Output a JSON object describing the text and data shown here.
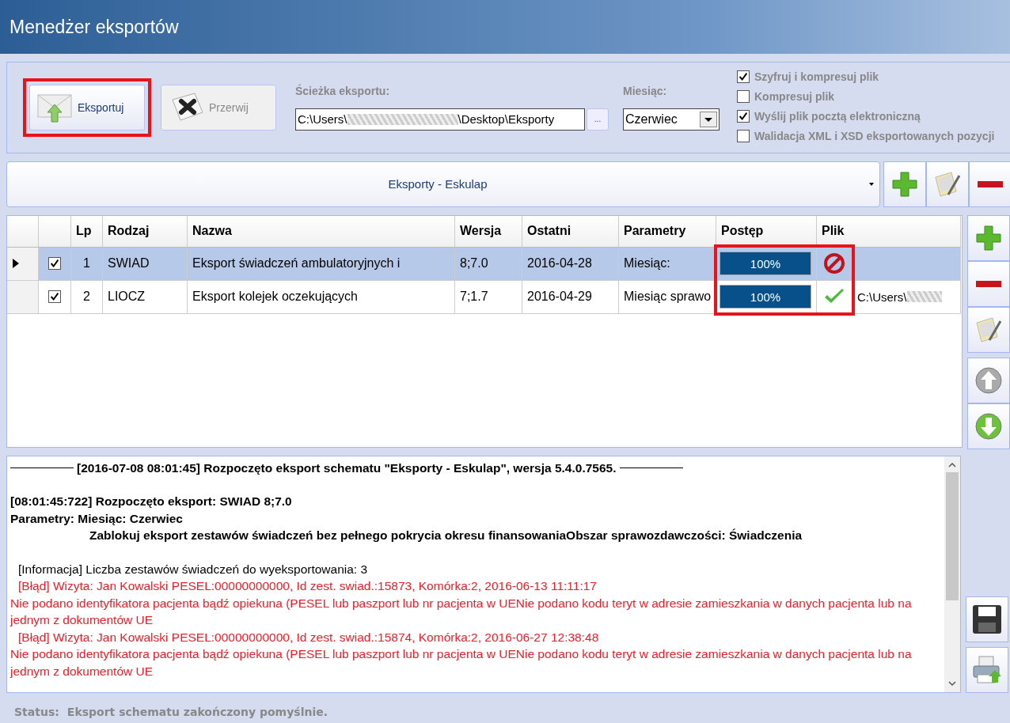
{
  "window": {
    "title": "Menedżer eksportów"
  },
  "toolbar": {
    "buttons": [
      {
        "label": "Eksportuj",
        "kind": "export",
        "disabled": false,
        "highlighted": true
      },
      {
        "label": "Przerwij",
        "kind": "abort",
        "disabled": true,
        "highlighted": false
      }
    ],
    "path": {
      "label": "Ścieżka eksportu:",
      "value_start": "C:\\Users\\",
      "value_end": "\\Desktop\\Eksporty",
      "browse": "..."
    },
    "month": {
      "label": "Miesiąc:",
      "value": "Czerwiec"
    },
    "options": [
      {
        "label": "Szyfruj i kompresuj plik",
        "checked": true
      },
      {
        "label": "Kompresuj plik",
        "checked": false
      },
      {
        "label": "Wyślij plik pocztą elektroniczną",
        "checked": true
      },
      {
        "label": "Walidacja XML i XSD eksportowanych pozycji",
        "checked": false
      }
    ]
  },
  "scheme": {
    "value": "Eksporty - Eskulap",
    "actions": [
      {
        "kind": "add"
      },
      {
        "kind": "edit"
      },
      {
        "kind": "remove"
      }
    ]
  },
  "table": {
    "columns": [
      "Lp",
      "Rodzaj",
      "Nazwa",
      "Wersja",
      "Ostatni",
      "Parametry",
      "Postęp",
      "Plik"
    ],
    "progress_highlighted": true,
    "rows": [
      {
        "selected": true,
        "checked": true,
        "lp": "1",
        "rodzaj": "SWIAD",
        "nazwa": "Eksport świadczeń ambulatoryjnych i",
        "wersja": "8;7.0",
        "ostatni": "2016-04-28",
        "parametry": "Miesiąc:",
        "level": 1,
        "progress": "100%",
        "succeeded": false,
        "plik": ""
      },
      {
        "selected": false,
        "checked": true,
        "lp": "2",
        "rodzaj": "LIOCZ",
        "nazwa": "Eksport kolejek oczekujących",
        "wersja": "7;1.7",
        "ostatni": "2016-04-29",
        "parametry": "Miesiąc sprawo",
        "level": 1,
        "progress": "100%",
        "succeeded": true,
        "plik": "C:\\Users\\"
      }
    ],
    "actions": [
      {
        "kind": "add"
      },
      {
        "kind": "remove"
      },
      {
        "kind": "edit"
      },
      {
        "kind": "up"
      },
      {
        "kind": "down"
      }
    ]
  },
  "log": {
    "lines": [
      {
        "kind": "header",
        "text": "[2016-07-08 08:01:45] Rozpoczęto eksport schematu \"Eksporty - Eskulap\", wersja 5.4.0.7565."
      },
      {
        "kind": "bold",
        "text": "[08:01:45:722] Rozpoczęto eksport: SWIAD 8;7.0"
      },
      {
        "kind": "bold",
        "text": "Parametry: Miesiąc: Czerwiec"
      },
      {
        "kind": "bold-indent",
        "text": "Zablokuj eksport zestawów świadczeń bez pełnego pokrycia okresu finansowaniaObszar sprawozdawczości: Świadczenia"
      },
      {
        "kind": "info",
        "text": "[Informacja] Liczba zestawów świadczeń do wyeksportowania: 3"
      },
      {
        "kind": "error",
        "text": "[Błąd] Wizyta: Jan Kowalski PESEL:00000000000, Id zest. swiad.:15873, Komórka:2, 2016-06-13 11:11:17"
      },
      {
        "kind": "error-detail",
        "text": "Nie podano identyfikatora pacjenta bądź opiekuna (PESEL lub paszport lub nr pacjenta w UENie podano kodu teryt w adresie zamieszkania w danych pacjenta lub na jednym z dokumentów UE"
      },
      {
        "kind": "error",
        "text": "[Błąd] Wizyta: Jan Kowalski PESEL:00000000000, Id zest. swiad.:15874, Komórka:2, 2016-06-27 12:38:48"
      },
      {
        "kind": "error-detail",
        "text": "Nie podano identyfikatora pacjenta bądź opiekuna (PESEL lub paszport lub nr pacjenta w UENie podano kodu teryt w adresie zamieszkania w danych pacjenta lub na jednym z dokumentów UE"
      }
    ],
    "actions": [
      {
        "kind": "save"
      },
      {
        "kind": "print"
      }
    ]
  },
  "status_bar": {
    "label": "Status:",
    "text": "Eksport schematu zakończony pomyślnie."
  }
}
